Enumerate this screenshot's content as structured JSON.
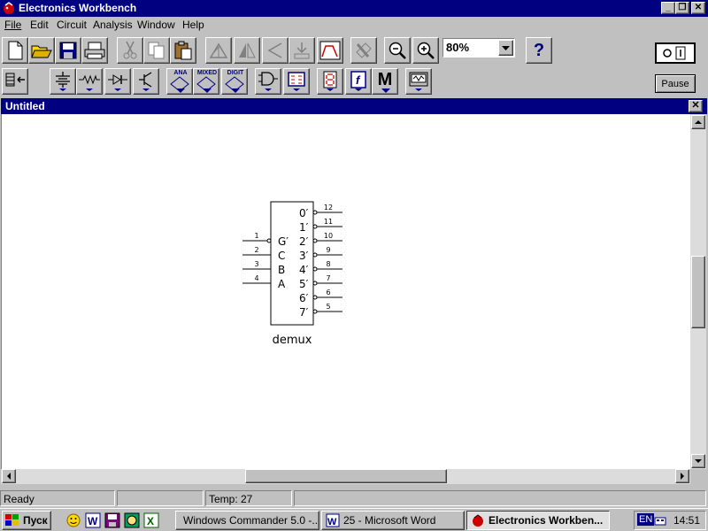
{
  "app": {
    "title": "Electronics Workbench",
    "window_controls": {
      "minimize": "_",
      "maximize": "❐",
      "close": "✕"
    }
  },
  "menu": [
    {
      "label": "File"
    },
    {
      "label": "Edit"
    },
    {
      "label": "Circuit"
    },
    {
      "label": "Analysis"
    },
    {
      "label": "Window"
    },
    {
      "label": "Help"
    }
  ],
  "toolbar": {
    "buttons": [
      "new-icon",
      "open-icon",
      "save-icon",
      "print-icon",
      "cut-icon",
      "copy-icon",
      "paste-icon",
      "rotate-icon",
      "flip-horizontal-icon",
      "flip-vertical-icon",
      "component-properties-icon",
      "create-subcircuit-icon",
      "graphs-icon",
      "help-pointer-icon",
      "zoom-out-icon",
      "zoom-in-icon",
      "help-icon"
    ],
    "zoom": {
      "value": "80%"
    },
    "help_label": "?",
    "pause_label": "Pause"
  },
  "parts_bin": {
    "labels": {
      "analog": "ANA",
      "mixed": "MIXED",
      "digital": "DIGIT",
      "misc": "M"
    }
  },
  "document": {
    "title": "Untitled",
    "close_label": "✕",
    "component": {
      "name": "demux",
      "inputs": [
        {
          "pin": "1",
          "label": "G′"
        },
        {
          "pin": "2",
          "label": "C"
        },
        {
          "pin": "3",
          "label": "B"
        },
        {
          "pin": "4",
          "label": "A"
        }
      ],
      "outputs": [
        {
          "pin": "12",
          "label": "0′"
        },
        {
          "pin": "11",
          "label": "1′"
        },
        {
          "pin": "10",
          "label": "2′"
        },
        {
          "pin": "9",
          "label": "3′"
        },
        {
          "pin": "8",
          "label": "4′"
        },
        {
          "pin": "7",
          "label": "5′"
        },
        {
          "pin": "6",
          "label": "6′"
        },
        {
          "pin": "5",
          "label": "7′"
        }
      ]
    }
  },
  "status": {
    "ready": "Ready",
    "pane2": "",
    "temp": "Temp:  27"
  },
  "taskbar": {
    "start_label": "Пуск",
    "tasks": [
      {
        "label": "Windows Commander 5.0 -...",
        "active": false
      },
      {
        "label": "25 - Microsoft Word",
        "active": false
      },
      {
        "label": "Electronics Workben...",
        "active": true
      }
    ],
    "tray": {
      "lang": "EN",
      "clock": "14:51"
    }
  },
  "colors": {
    "titlebar": "#000080",
    "face": "#c0c0c0",
    "canvas": "#ffffff"
  }
}
